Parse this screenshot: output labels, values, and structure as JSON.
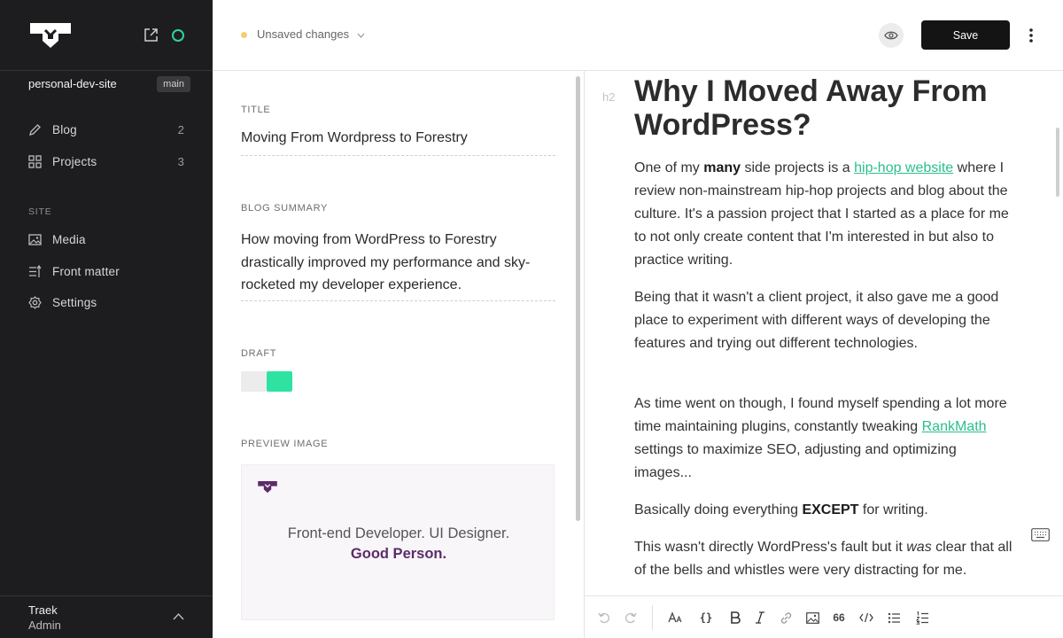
{
  "sidebar": {
    "site_name": "personal-dev-site",
    "branch": "main",
    "nav": [
      {
        "label": "Blog",
        "count": "2",
        "icon": "pencil-icon"
      },
      {
        "label": "Projects",
        "count": "3",
        "icon": "grid-icon"
      }
    ],
    "section_label": "SITE",
    "site_nav": [
      {
        "label": "Media",
        "icon": "image-icon"
      },
      {
        "label": "Front matter",
        "icon": "sliders-icon"
      },
      {
        "label": "Settings",
        "icon": "gear-icon"
      }
    ],
    "user": {
      "name": "Traek",
      "role": "Admin"
    }
  },
  "header": {
    "status": "Unsaved changes",
    "save_label": "Save"
  },
  "form": {
    "title_label": "TITLE",
    "title_value": "Moving From Wordpress to Forestry",
    "summary_label": "BLOG SUMMARY",
    "summary_value": "How moving from WordPress to Forestry drastically improved my performance and sky-rocketed my developer experience.",
    "draft_label": "DRAFT",
    "draft_value": true,
    "preview_label": "PREVIEW IMAGE",
    "preview_line1": "Front-end Developer. UI Designer.",
    "preview_line2": "Good Person."
  },
  "editor": {
    "block_tag": "h2",
    "heading": "Why I Moved Away From WordPress?",
    "p1_a": "One of my ",
    "p1_bold": "many",
    "p1_b": " side projects is a ",
    "p1_link": "hip-hop website",
    "p1_c": " where I review non-mainstream hip-hop projects and blog about the culture. It's a passion project that I started as a place for me to not only create content that I'm interested in but also to practice writing.",
    "p2": "Being that it wasn't a client project, it also gave me a good place to experiment with different ways of developing the features and trying out different technologies.",
    "p3_a": "As time went on though, I found myself spending a lot more time maintaining plugins, constantly tweaking ",
    "p3_link": "RankMath",
    "p3_b": " settings to maximize SEO, adjusting and optimizing images...",
    "p4_a": "Basically doing everything ",
    "p4_bold": "EXCEPT",
    "p4_b": " for writing.",
    "p5_a": "This wasn't directly WordPress's fault but it ",
    "p5_em": "was",
    "p5_b": " clear that all of the bells and whistles were very distracting for me."
  },
  "toolbar": {
    "quote_label": "66",
    "code_block_label": "{}"
  },
  "colors": {
    "sidebar_bg": "#1d1d1f",
    "accent": "#2ed3a0",
    "unsaved_dot": "#f5cf6c",
    "brand_purple": "#5c2b6a",
    "link": "#2bbf8c"
  }
}
